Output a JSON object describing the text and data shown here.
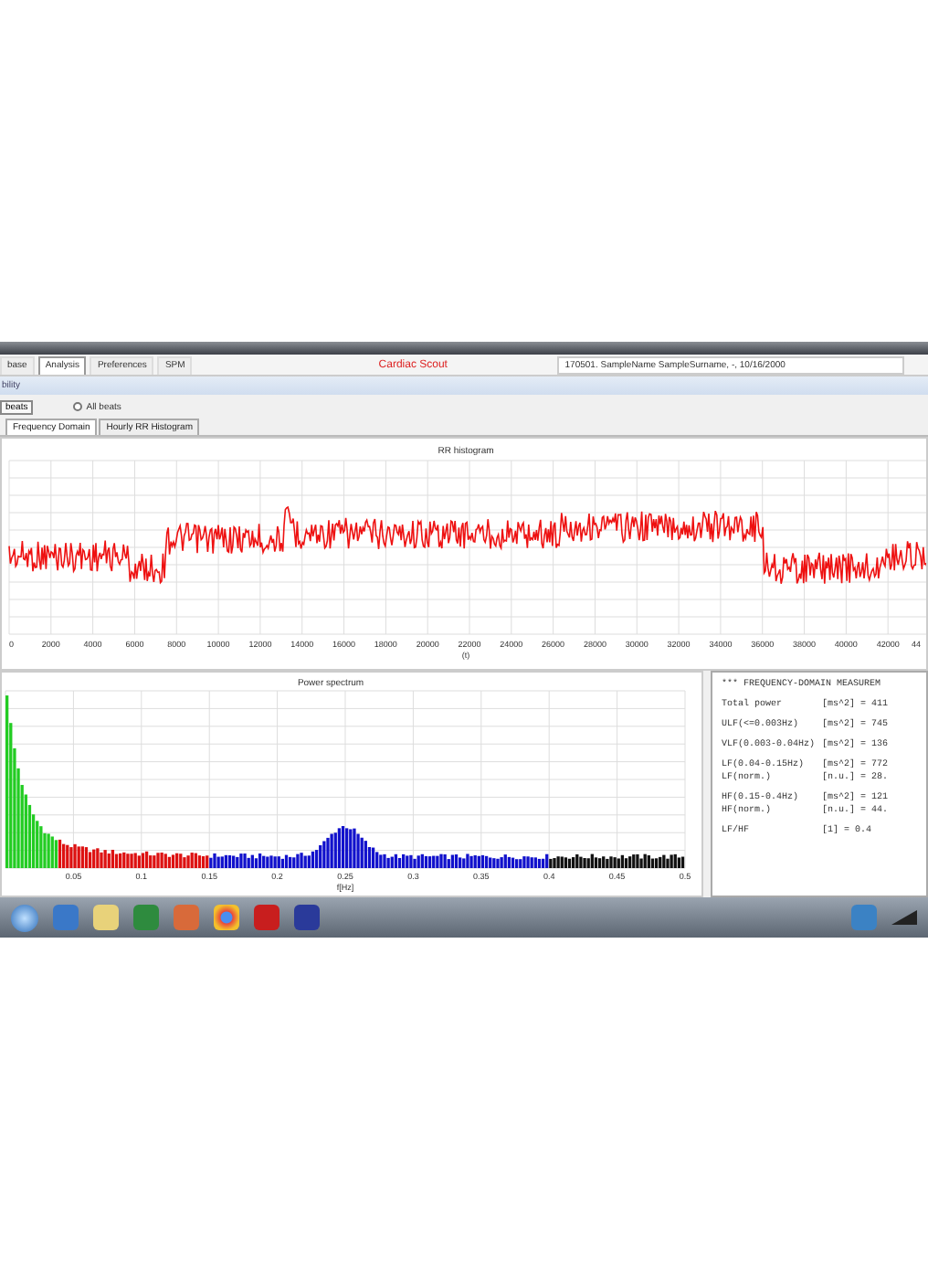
{
  "tabs": [
    {
      "label": "base",
      "selected": false
    },
    {
      "label": "Analysis",
      "selected": true
    },
    {
      "label": "Preferences",
      "selected": false
    },
    {
      "label": "SPM",
      "selected": false
    }
  ],
  "app_title": "Cardiac Scout",
  "patient": "170501. SampleName SampleSurname, -, 10/16/2000",
  "section": "bility",
  "beats_button": "beats",
  "radio": {
    "label": "All beats",
    "selected": false
  },
  "subtabs": [
    {
      "label": "Frequency Domain",
      "selected": true
    },
    {
      "label": "Hourly RR Histogram",
      "selected": false
    }
  ],
  "rr_chart": {
    "title": "RR histogram",
    "x_ticks": [
      "0",
      "2000",
      "4000",
      "6000",
      "8000",
      "10000",
      "12000",
      "14000",
      "16000",
      "18000",
      "20000",
      "22000",
      "24000",
      "26000",
      "28000",
      "30000",
      "32000",
      "34000",
      "36000",
      "38000",
      "40000",
      "42000",
      "44"
    ],
    "x_label": "(t)"
  },
  "spectrum": {
    "title": "Power spectrum",
    "x_ticks": [
      "0.05",
      "0.1",
      "0.15",
      "0.2",
      "0.25",
      "0.3",
      "0.35",
      "0.4",
      "0.45",
      "0.5"
    ],
    "x_label": "f[Hz]"
  },
  "results": {
    "heading": "*** FREQUENCY-DOMAIN MEASUREM",
    "groups": [
      [
        {
          "label": "Total power",
          "value": "[ms^2] = 411"
        }
      ],
      [
        {
          "label": "ULF(<=0.003Hz)",
          "value": "[ms^2] = 745"
        }
      ],
      [
        {
          "label": "VLF(0.003-0.04Hz)",
          "value": "[ms^2] = 136"
        }
      ],
      [
        {
          "label": "LF(0.04-0.15Hz)",
          "value": "[ms^2] = 772"
        },
        {
          "label": "LF(norm.)",
          "value": "[n.u.] = 28."
        }
      ],
      [
        {
          "label": "HF(0.15-0.4Hz)",
          "value": "[ms^2] = 121"
        },
        {
          "label": "HF(norm.)",
          "value": "[n.u.] = 44."
        }
      ],
      [
        {
          "label": "LF/HF",
          "value": "[1] = 0.4"
        }
      ]
    ]
  }
}
